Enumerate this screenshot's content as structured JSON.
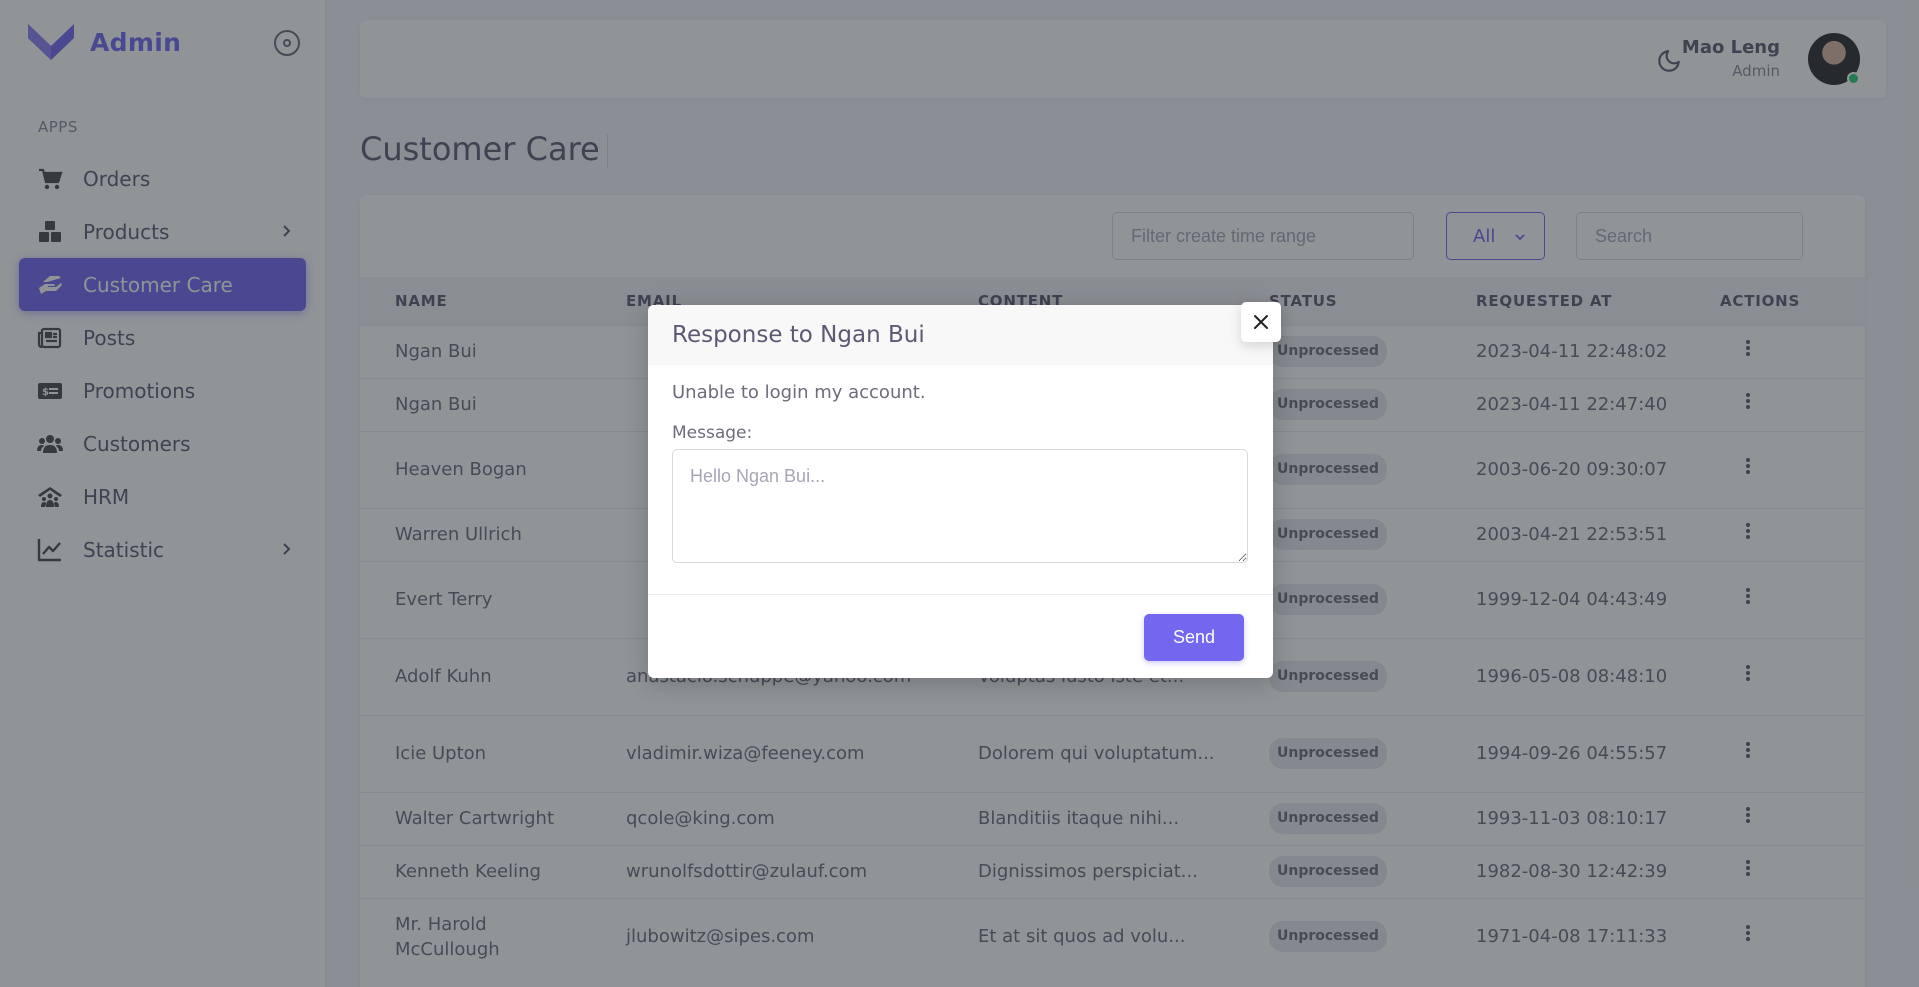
{
  "brand": {
    "name": "Admin"
  },
  "sidebar": {
    "section_label": "APPS",
    "items": [
      {
        "label": "Orders",
        "icon": "cart-icon",
        "has_children": false,
        "active": false
      },
      {
        "label": "Products",
        "icon": "boxes-icon",
        "has_children": true,
        "active": false
      },
      {
        "label": "Customer Care",
        "icon": "hand-holding-icon",
        "has_children": false,
        "active": true
      },
      {
        "label": "Posts",
        "icon": "newspaper-icon",
        "has_children": false,
        "active": false
      },
      {
        "label": "Promotions",
        "icon": "money-bill-icon",
        "has_children": false,
        "active": false
      },
      {
        "label": "Customers",
        "icon": "users-icon",
        "has_children": false,
        "active": false
      },
      {
        "label": "HRM",
        "icon": "people-roof-icon",
        "has_children": false,
        "active": false
      },
      {
        "label": "Statistic",
        "icon": "chart-line-icon",
        "has_children": true,
        "active": false
      }
    ]
  },
  "header": {
    "user_name": "Mao Leng",
    "user_role": "Admin"
  },
  "page": {
    "title": "Customer Care"
  },
  "filters": {
    "time_range_placeholder": "Filter create time range",
    "status_value": "All",
    "search_placeholder": "Search"
  },
  "table": {
    "columns": [
      "NAME",
      "EMAIL",
      "CONTENT",
      "STATUS",
      "REQUESTED AT",
      "ACTIONS"
    ],
    "rows": [
      {
        "name": "Ngan Bui",
        "email": "",
        "content": "",
        "status": "Unprocessed",
        "requested_at": "2023-04-11 22:48:02"
      },
      {
        "name": "Ngan Bui",
        "email": "",
        "content": "",
        "status": "Unprocessed",
        "requested_at": "2023-04-11 22:47:40"
      },
      {
        "name": "Heaven Bogan",
        "email": "",
        "content": "",
        "status": "Unprocessed",
        "requested_at": "2003-06-20 09:30:07"
      },
      {
        "name": "Warren Ullrich",
        "email": "",
        "content": "",
        "status": "Unprocessed",
        "requested_at": "2003-04-21 22:53:51"
      },
      {
        "name": "Evert Terry",
        "email": "",
        "content": "",
        "status": "Unprocessed",
        "requested_at": "1999-12-04 04:43:49"
      },
      {
        "name": "Adolf Kuhn",
        "email": "anastacio.schuppe@yahoo.com",
        "content": "Voluptas iusto iste et...",
        "status": "Unprocessed",
        "requested_at": "1996-05-08 08:48:10"
      },
      {
        "name": "Icie Upton",
        "email": "vladimir.wiza@feeney.com",
        "content": "Dolorem qui voluptatum...",
        "status": "Unprocessed",
        "requested_at": "1994-09-26 04:55:57"
      },
      {
        "name": "Walter Cartwright",
        "email": "qcole@king.com",
        "content": "Blanditiis itaque nihi...",
        "status": "Unprocessed",
        "requested_at": "1993-11-03 08:10:17"
      },
      {
        "name": "Kenneth Keeling",
        "email": "wrunolfsdottir@zulauf.com",
        "content": "Dignissimos perspiciat...",
        "status": "Unprocessed",
        "requested_at": "1982-08-30 12:42:39"
      },
      {
        "name": "Mr. Harold McCullough",
        "email": "jlubowitz@sipes.com",
        "content": "Et at sit quos ad volu...",
        "status": "Unprocessed",
        "requested_at": "1971-04-08 17:11:33"
      }
    ]
  },
  "modal": {
    "title": "Response to Ngan Bui",
    "content_text": "Unable to login my account.",
    "message_label": "Message:",
    "message_placeholder": "Hello Ngan Bui...",
    "message_value": "",
    "send_label": "Send"
  },
  "colors": {
    "accent": "#7367f0",
    "overlay": "rgba(34,41,47,0.5)",
    "online": "#28c76f"
  }
}
